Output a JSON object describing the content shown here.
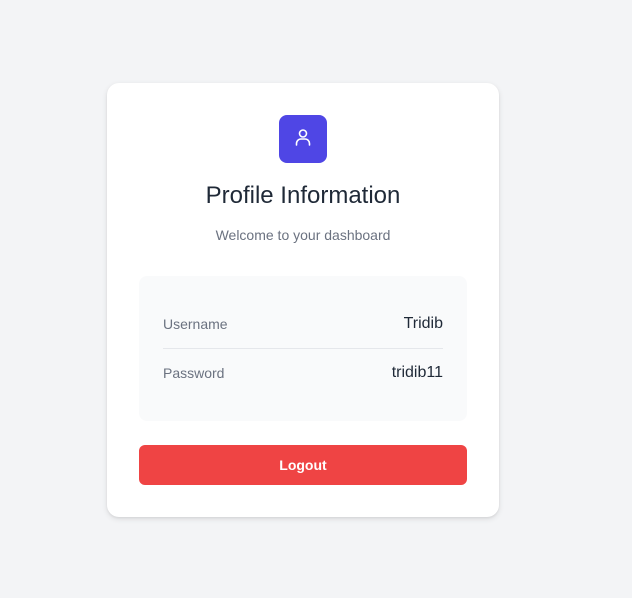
{
  "profile_card": {
    "icon": "user-icon",
    "title": "Profile Information",
    "subtitle": "Welcome to your dashboard",
    "fields": [
      {
        "label": "Username",
        "value": "Tridib"
      },
      {
        "label": "Password",
        "value": "tridib11"
      }
    ],
    "logout_label": "Logout"
  },
  "colors": {
    "background": "#f3f4f6",
    "card": "#ffffff",
    "accent": "#4f46e5",
    "danger": "#ef4444",
    "panel": "#f9fafb",
    "text_primary": "#1f2937",
    "text_secondary": "#6b7280"
  }
}
